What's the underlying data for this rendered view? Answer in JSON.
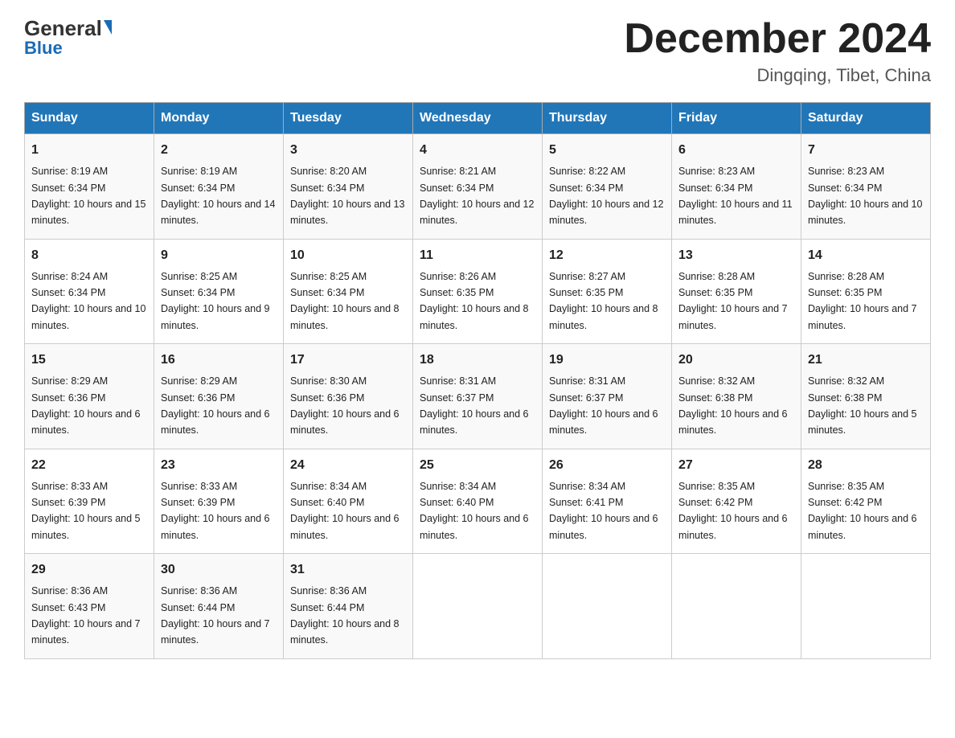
{
  "logo": {
    "general": "General",
    "blue": "Blue",
    "subtitle": "Blue"
  },
  "header": {
    "month_title": "December 2024",
    "location": "Dingqing, Tibet, China"
  },
  "days_of_week": [
    "Sunday",
    "Monday",
    "Tuesday",
    "Wednesday",
    "Thursday",
    "Friday",
    "Saturday"
  ],
  "weeks": [
    [
      {
        "day": "1",
        "sunrise": "8:19 AM",
        "sunset": "6:34 PM",
        "daylight": "10 hours and 15 minutes."
      },
      {
        "day": "2",
        "sunrise": "8:19 AM",
        "sunset": "6:34 PM",
        "daylight": "10 hours and 14 minutes."
      },
      {
        "day": "3",
        "sunrise": "8:20 AM",
        "sunset": "6:34 PM",
        "daylight": "10 hours and 13 minutes."
      },
      {
        "day": "4",
        "sunrise": "8:21 AM",
        "sunset": "6:34 PM",
        "daylight": "10 hours and 12 minutes."
      },
      {
        "day": "5",
        "sunrise": "8:22 AM",
        "sunset": "6:34 PM",
        "daylight": "10 hours and 12 minutes."
      },
      {
        "day": "6",
        "sunrise": "8:23 AM",
        "sunset": "6:34 PM",
        "daylight": "10 hours and 11 minutes."
      },
      {
        "day": "7",
        "sunrise": "8:23 AM",
        "sunset": "6:34 PM",
        "daylight": "10 hours and 10 minutes."
      }
    ],
    [
      {
        "day": "8",
        "sunrise": "8:24 AM",
        "sunset": "6:34 PM",
        "daylight": "10 hours and 10 minutes."
      },
      {
        "day": "9",
        "sunrise": "8:25 AM",
        "sunset": "6:34 PM",
        "daylight": "10 hours and 9 minutes."
      },
      {
        "day": "10",
        "sunrise": "8:25 AM",
        "sunset": "6:34 PM",
        "daylight": "10 hours and 8 minutes."
      },
      {
        "day": "11",
        "sunrise": "8:26 AM",
        "sunset": "6:35 PM",
        "daylight": "10 hours and 8 minutes."
      },
      {
        "day": "12",
        "sunrise": "8:27 AM",
        "sunset": "6:35 PM",
        "daylight": "10 hours and 8 minutes."
      },
      {
        "day": "13",
        "sunrise": "8:28 AM",
        "sunset": "6:35 PM",
        "daylight": "10 hours and 7 minutes."
      },
      {
        "day": "14",
        "sunrise": "8:28 AM",
        "sunset": "6:35 PM",
        "daylight": "10 hours and 7 minutes."
      }
    ],
    [
      {
        "day": "15",
        "sunrise": "8:29 AM",
        "sunset": "6:36 PM",
        "daylight": "10 hours and 6 minutes."
      },
      {
        "day": "16",
        "sunrise": "8:29 AM",
        "sunset": "6:36 PM",
        "daylight": "10 hours and 6 minutes."
      },
      {
        "day": "17",
        "sunrise": "8:30 AM",
        "sunset": "6:36 PM",
        "daylight": "10 hours and 6 minutes."
      },
      {
        "day": "18",
        "sunrise": "8:31 AM",
        "sunset": "6:37 PM",
        "daylight": "10 hours and 6 minutes."
      },
      {
        "day": "19",
        "sunrise": "8:31 AM",
        "sunset": "6:37 PM",
        "daylight": "10 hours and 6 minutes."
      },
      {
        "day": "20",
        "sunrise": "8:32 AM",
        "sunset": "6:38 PM",
        "daylight": "10 hours and 6 minutes."
      },
      {
        "day": "21",
        "sunrise": "8:32 AM",
        "sunset": "6:38 PM",
        "daylight": "10 hours and 5 minutes."
      }
    ],
    [
      {
        "day": "22",
        "sunrise": "8:33 AM",
        "sunset": "6:39 PM",
        "daylight": "10 hours and 5 minutes."
      },
      {
        "day": "23",
        "sunrise": "8:33 AM",
        "sunset": "6:39 PM",
        "daylight": "10 hours and 6 minutes."
      },
      {
        "day": "24",
        "sunrise": "8:34 AM",
        "sunset": "6:40 PM",
        "daylight": "10 hours and 6 minutes."
      },
      {
        "day": "25",
        "sunrise": "8:34 AM",
        "sunset": "6:40 PM",
        "daylight": "10 hours and 6 minutes."
      },
      {
        "day": "26",
        "sunrise": "8:34 AM",
        "sunset": "6:41 PM",
        "daylight": "10 hours and 6 minutes."
      },
      {
        "day": "27",
        "sunrise": "8:35 AM",
        "sunset": "6:42 PM",
        "daylight": "10 hours and 6 minutes."
      },
      {
        "day": "28",
        "sunrise": "8:35 AM",
        "sunset": "6:42 PM",
        "daylight": "10 hours and 6 minutes."
      }
    ],
    [
      {
        "day": "29",
        "sunrise": "8:36 AM",
        "sunset": "6:43 PM",
        "daylight": "10 hours and 7 minutes."
      },
      {
        "day": "30",
        "sunrise": "8:36 AM",
        "sunset": "6:44 PM",
        "daylight": "10 hours and 7 minutes."
      },
      {
        "day": "31",
        "sunrise": "8:36 AM",
        "sunset": "6:44 PM",
        "daylight": "10 hours and 8 minutes."
      },
      null,
      null,
      null,
      null
    ]
  ]
}
